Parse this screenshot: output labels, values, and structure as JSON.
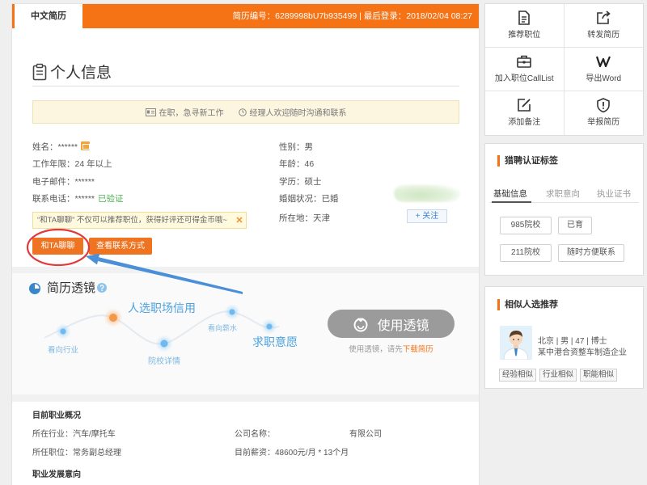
{
  "colors": {
    "brand_orange": "#f57215",
    "button_orange": "#ef7421",
    "verified_green": "#4caf50",
    "lens_blue": "#4aa3df",
    "annotation_red": "#e03a3a",
    "annotation_blue": "#4a8fd8"
  },
  "header": {
    "tab_label": "中文简历",
    "meta": "简历编号：6289998bU7b935499 | 最后登录：2018/02/04 08:27"
  },
  "personal_info": {
    "title": "个人信息",
    "title_icon": "clipboard-icon",
    "status": [
      {
        "icon": "id-card-icon",
        "text": "在职，急寻新工作"
      },
      {
        "icon": "clock-icon",
        "text": "经理人欢迎随时沟通和联系"
      }
    ],
    "left_fields": [
      {
        "label": "姓名：",
        "value": "******",
        "icon": "photo-icon"
      },
      {
        "label": "工作年限：",
        "value": "24 年以上"
      },
      {
        "label": "电子邮件：",
        "value": "******"
      },
      {
        "label": "联系电话：",
        "value": "******",
        "badge": "已验证"
      }
    ],
    "right_fields": [
      {
        "label": "性别：",
        "value": "男"
      },
      {
        "label": "年龄：",
        "value": "46"
      },
      {
        "label": "学历：",
        "value": "硕士"
      },
      {
        "label": "婚姻状况：",
        "value": "已婚"
      },
      {
        "label": "所在地：",
        "value": "天津"
      }
    ],
    "follow_button": "+ 关注",
    "tip": "“和TA聊聊” 不仅可以推荐职位，获得好评还可得金币哦~",
    "tip_close_icon": "close-icon",
    "chat_button": "和TA聊聊",
    "contact_button": "查看联系方式"
  },
  "lens": {
    "title": "简历透镜",
    "icon": "pie-chart-icon",
    "nodes": [
      "看向行业",
      "人选职场信用",
      "院校详情",
      "看向薪水",
      "求职意愿"
    ],
    "button": "使用透镜",
    "hint": "使用透镜，请先",
    "hint_link": "下载简历"
  },
  "career": {
    "title": "目前职业概况",
    "industry": "所在行业：汽车/摩托车",
    "company_label": "公司名称：",
    "company_value": "有限公司",
    "position": "所任职位：常务副总经理",
    "salary": "目前薪资：48600元/月 * 13个月",
    "next_title": "职业发展意向"
  },
  "sidebar": {
    "actions": [
      {
        "label": "推荐职位",
        "icon": "recommend-icon"
      },
      {
        "label": "转发简历",
        "icon": "forward-icon"
      },
      {
        "label": "加入职位CallList",
        "icon": "briefcase-icon"
      },
      {
        "label": "导出Word",
        "icon": "word-icon"
      },
      {
        "label": "添加备注",
        "icon": "edit-icon"
      },
      {
        "label": "举报简历",
        "icon": "shield-alert-icon"
      }
    ],
    "certification": {
      "title": "猎聘认证标签",
      "tabs": [
        "基础信息",
        "求职意向",
        "执业证书"
      ],
      "active_tab": "基础信息",
      "tags": [
        "985院校",
        "已育",
        "211院校",
        "随时方便联系"
      ]
    },
    "similar": {
      "title": "相似人选推荐",
      "info": "北京 | 男 | 47 | 博士",
      "company": "某中港合资整车制造企业",
      "buttons": [
        "经验相似",
        "行业相似",
        "职能相似"
      ]
    }
  }
}
